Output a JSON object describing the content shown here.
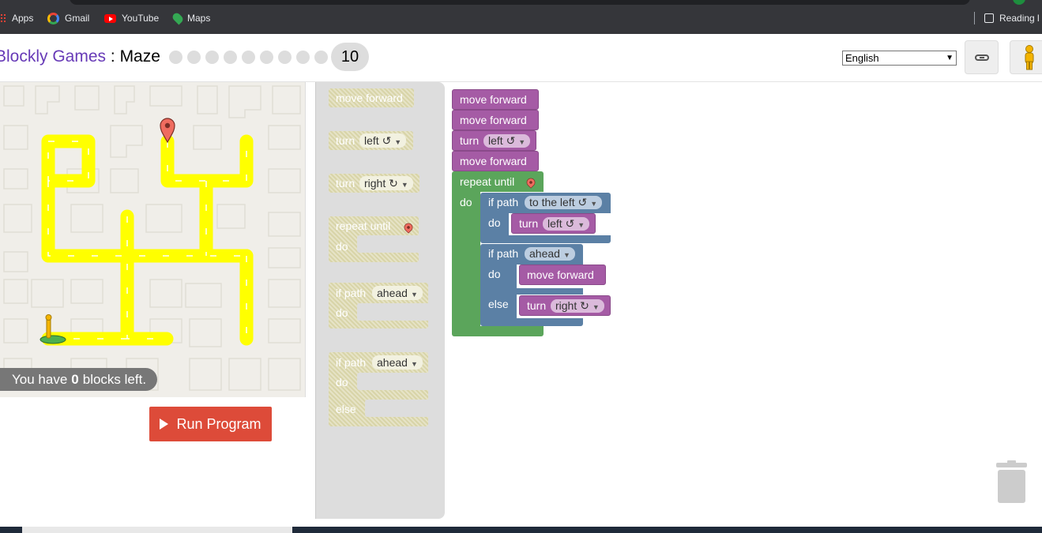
{
  "browser": {
    "bookmarks": [
      {
        "label": "Apps",
        "icon": "apps-icon"
      },
      {
        "label": "Gmail",
        "icon": "gmail-icon"
      },
      {
        "label": "YouTube",
        "icon": "youtube-icon"
      },
      {
        "label": "Maps",
        "icon": "maps-icon"
      }
    ],
    "reading_list": "Reading l"
  },
  "header": {
    "title_games": "Blockly Games",
    "title_sep": " : ",
    "title_app": "Maze",
    "current_level": "10",
    "language": "English"
  },
  "maze": {
    "blocks_left_prefix": "You have ",
    "blocks_left_count": "0",
    "blocks_left_suffix": " blocks left.",
    "run_label": "Run Program"
  },
  "toolbox": {
    "move_forward": "move forward",
    "turn": "turn",
    "left": "left ↺",
    "right": "right ↻",
    "repeat_until": "repeat until",
    "do": "do",
    "if_path": "if path",
    "ahead": "ahead",
    "else": "else"
  },
  "workspace": {
    "move_forward": "move forward",
    "turn": "turn",
    "left": "left ↺",
    "right": "right ↻",
    "repeat_until": "repeat until",
    "do": "do",
    "if_path": "if path",
    "to_the_left": "to the left ↺",
    "ahead": "ahead",
    "else": "else"
  },
  "colors": {
    "motion_block": "#a55ba5",
    "loop_block": "#5ba55b",
    "logic_block": "#5b80a5",
    "path": "#ffff00",
    "run_button": "#dd4b39",
    "title_accent": "#673ab7"
  }
}
